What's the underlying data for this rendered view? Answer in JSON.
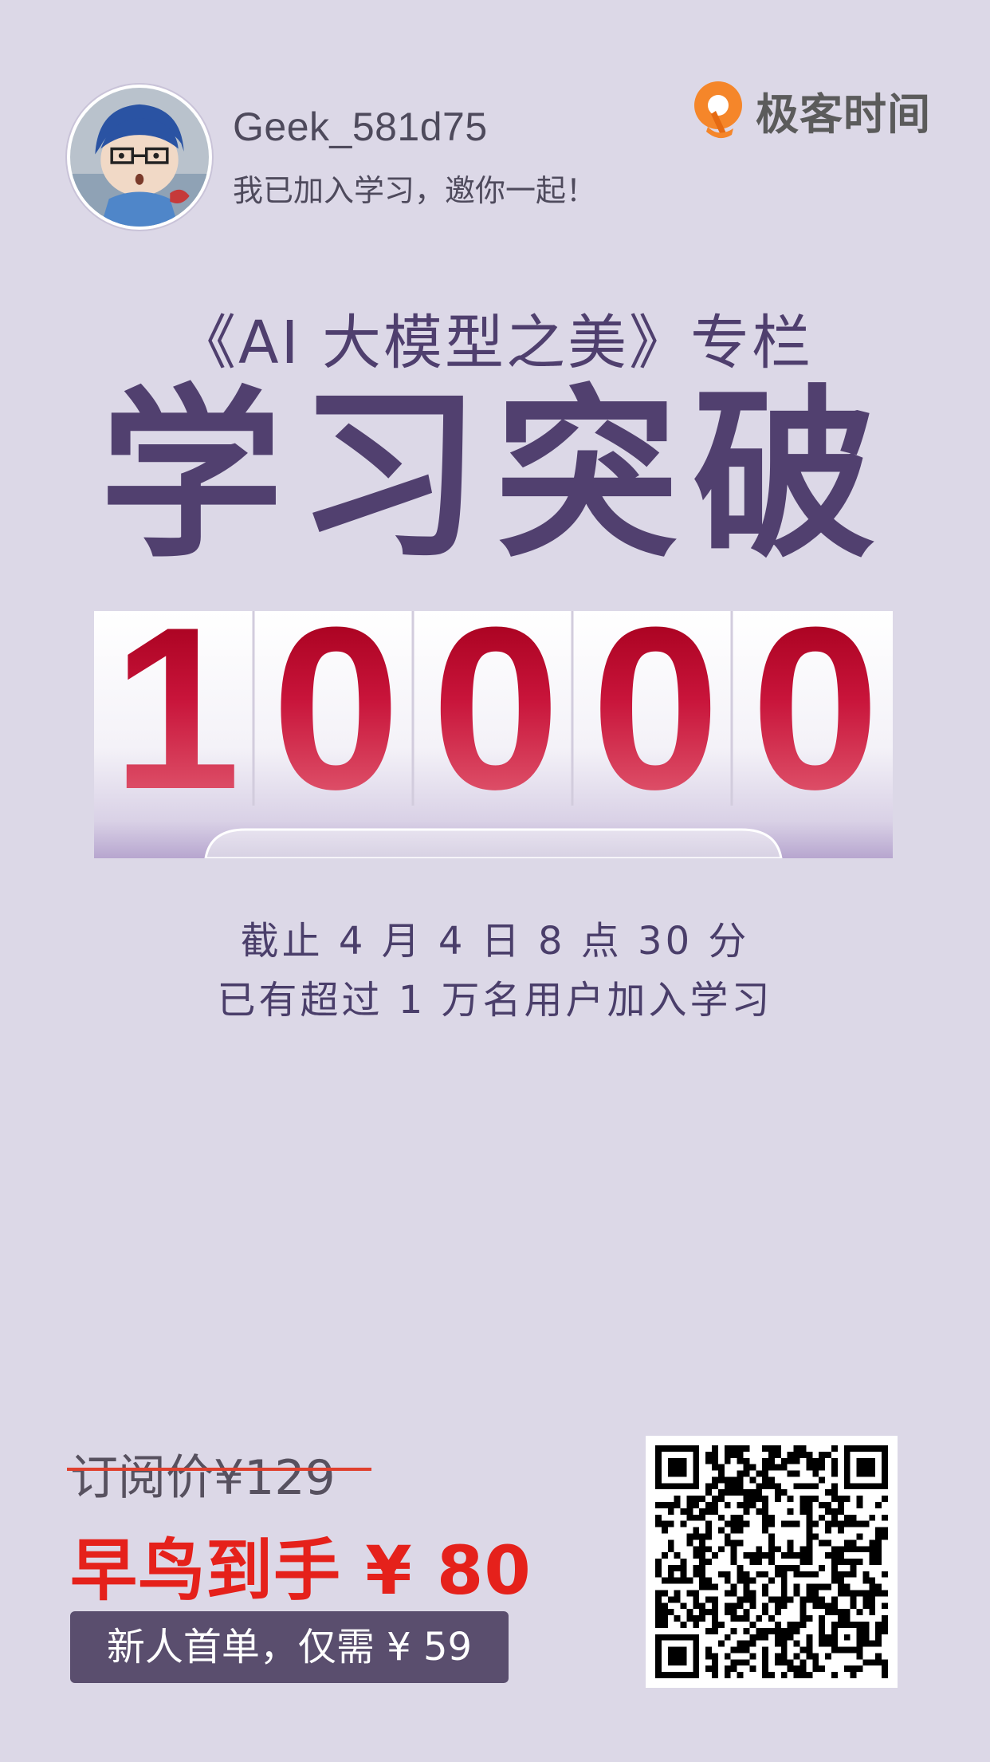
{
  "header": {
    "user_name": "Geek_581d75",
    "slogan": "我已加入学习，邀你一起！",
    "brand_name": "极客时间",
    "brand_color": "#f5862a"
  },
  "headline": {
    "column_title": "《AI 大模型之美》专栏",
    "main": "学习突破",
    "counter_digits": [
      "1",
      "0",
      "0",
      "0",
      "0"
    ],
    "digit_color": "#c11a34"
  },
  "stats": {
    "line1": "截止 4 月 4 日 8 点 30 分",
    "line2": "已有超过 1 万名用户加入学习"
  },
  "pricing": {
    "original": "订阅价¥129",
    "early_bird": "早鸟到手 ¥ 80",
    "newbie": "新人首单，仅需 ¥ 59",
    "early_color": "#e5211b"
  },
  "qr": {
    "icon": "qr-code-icon"
  }
}
